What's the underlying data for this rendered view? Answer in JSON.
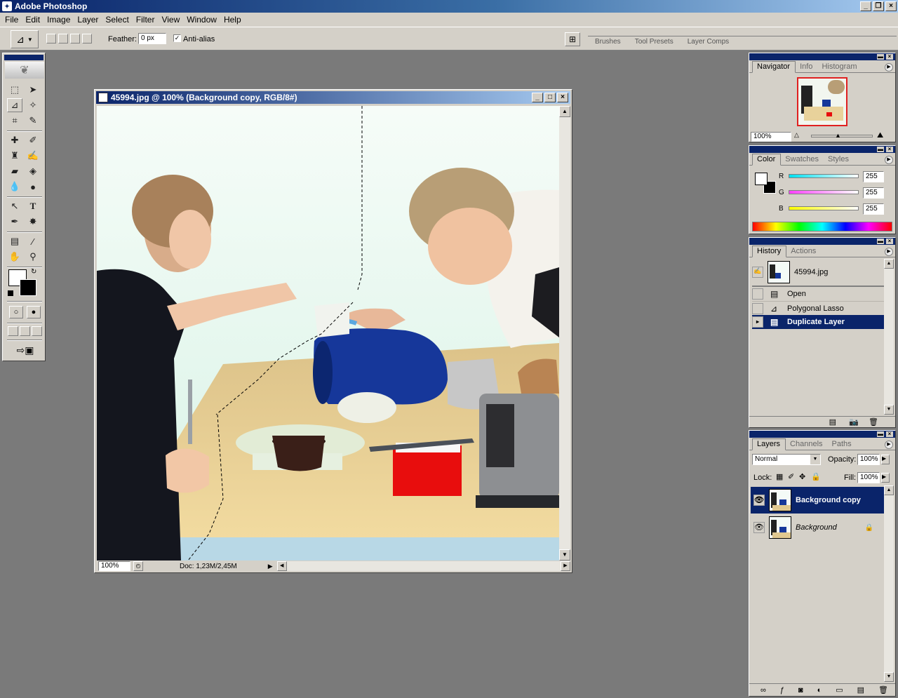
{
  "app": {
    "title": "Adobe Photoshop"
  },
  "menu": [
    "File",
    "Edit",
    "Image",
    "Layer",
    "Select",
    "Filter",
    "View",
    "Window",
    "Help"
  ],
  "options": {
    "feather_label": "Feather:",
    "feather_value": "0 px",
    "antialias_label": "Anti-alias",
    "well_tabs": [
      "Brushes",
      "Tool Presets",
      "Layer Comps"
    ]
  },
  "document": {
    "title": "45994.jpg @ 100% (Background copy, RGB/8#)",
    "zoom": "100%",
    "doc_info": "Doc: 1,23M/2,45M"
  },
  "navigator": {
    "tabs": [
      "Navigator",
      "Info",
      "Histogram"
    ],
    "zoom": "100%"
  },
  "color": {
    "tabs": [
      "Color",
      "Swatches",
      "Styles"
    ],
    "channels": [
      {
        "label": "R",
        "value": "255",
        "color": "#00e0f0"
      },
      {
        "label": "G",
        "value": "255",
        "color": "#ff40ff"
      },
      {
        "label": "B",
        "value": "255",
        "color": "#ffff00"
      }
    ]
  },
  "history": {
    "tabs": [
      "History",
      "Actions"
    ],
    "snapshot": "45994.jpg",
    "items": [
      "Open",
      "Polygonal Lasso",
      "Duplicate Layer"
    ]
  },
  "layers": {
    "tabs": [
      "Layers",
      "Channels",
      "Paths"
    ],
    "blend_mode": "Normal",
    "opacity_label": "Opacity:",
    "opacity": "100%",
    "lock_label": "Lock:",
    "fill_label": "Fill:",
    "fill": "100%",
    "items": [
      "Background copy",
      "Background"
    ]
  }
}
